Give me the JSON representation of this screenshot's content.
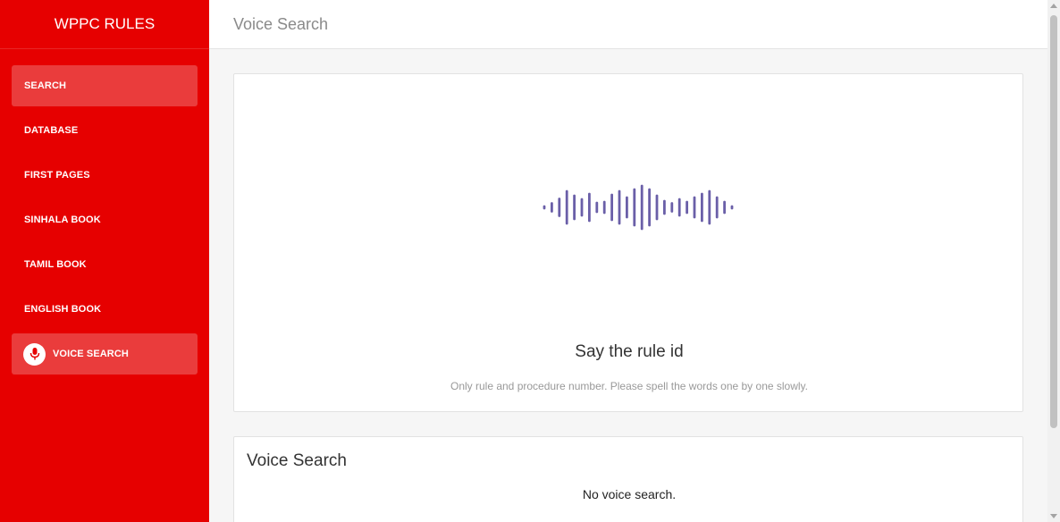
{
  "app": {
    "brand": "WPPC RULES",
    "accent_color": "#e60000"
  },
  "sidebar": {
    "items": [
      {
        "label": "SEARCH",
        "active": true
      },
      {
        "label": "DATABASE",
        "active": false
      },
      {
        "label": "FIRST PAGES",
        "active": false
      },
      {
        "label": "SINHALA BOOK",
        "active": false
      },
      {
        "label": "TAMIL BOOK",
        "active": false
      },
      {
        "label": "ENGLISH BOOK",
        "active": false
      },
      {
        "label": "VOICE SEARCH",
        "active": true,
        "icon": "microphone-icon"
      }
    ]
  },
  "header": {
    "title": "Voice Search"
  },
  "voice_panel": {
    "icon": "sound-wave-icon",
    "wave_color": "#6a5fa8",
    "prompt": "Say the rule id",
    "hint": "Only rule and procedure number. Please spell the words one by one slowly."
  },
  "results": {
    "title": "Voice Search",
    "empty_text": "No voice search."
  }
}
